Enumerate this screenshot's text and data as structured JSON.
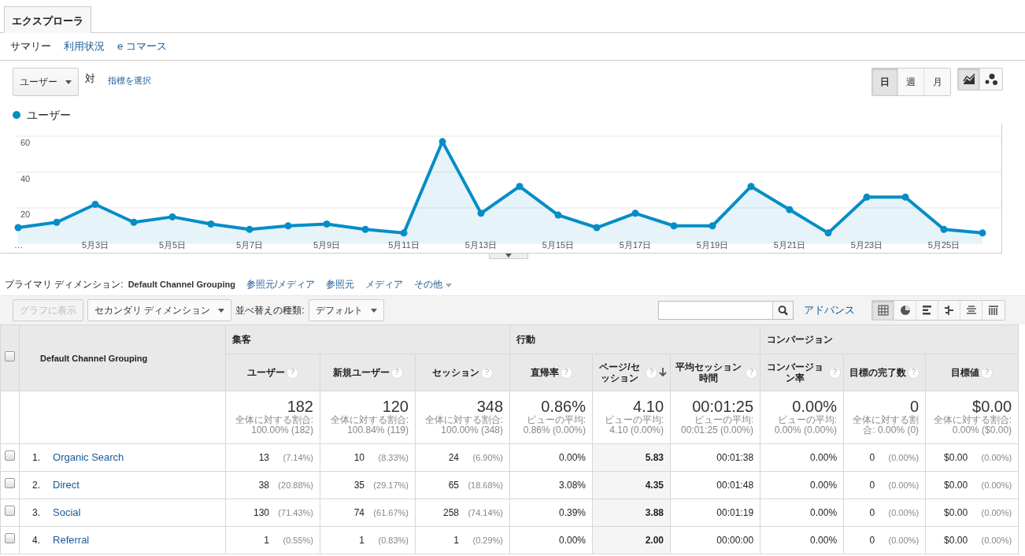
{
  "tabs": [
    {
      "label": "エクスプローラ",
      "selected": true
    }
  ],
  "subnav": [
    {
      "label": "サマリー",
      "selected": true
    },
    {
      "label": "利用状況",
      "selected": false
    },
    {
      "label": "e コマース",
      "selected": false
    }
  ],
  "metric_select": {
    "value": "ユーザー"
  },
  "vs_label": "対",
  "pick_metric_link": "指標を選択",
  "period_buttons": [
    {
      "label": "日",
      "selected": true
    },
    {
      "label": "週",
      "selected": false
    },
    {
      "label": "月",
      "selected": false
    }
  ],
  "chart_type_buttons": [
    {
      "kind": "line",
      "selected": true
    },
    {
      "kind": "motion",
      "selected": false
    }
  ],
  "chart": {
    "chart_data": {
      "type": "area",
      "categories": [
        "…",
        null,
        "5月3日",
        null,
        "5月5日",
        null,
        "5月7日",
        null,
        "5月9日",
        null,
        "5月11日",
        null,
        "5月13日",
        null,
        "5月15日",
        null,
        "5月17日",
        null,
        "5月19日",
        null,
        "5月21日",
        null,
        "5月23日",
        null,
        "5月25日",
        null
      ],
      "series": [
        {
          "name": "ユーザー",
          "color": "#058dc7",
          "values": [
            9,
            12,
            22,
            12,
            15,
            11,
            8,
            10,
            11,
            8,
            6,
            57,
            17,
            32,
            16,
            9,
            17,
            10,
            10,
            32,
            19,
            6,
            26,
            26,
            8,
            6
          ]
        }
      ],
      "ylim": [
        0,
        60
      ],
      "yticks": [
        20,
        40,
        60
      ],
      "grid": true
    }
  },
  "dimension_bar": {
    "label": "プライマリ ディメンション:",
    "items": [
      {
        "label": "Default Channel Grouping",
        "selected": true,
        "kind": "link"
      },
      {
        "label": "参照元/メディア",
        "selected": false,
        "kind": "link"
      },
      {
        "label": "参照元",
        "selected": false,
        "kind": "link"
      },
      {
        "label": "メディア",
        "selected": false,
        "kind": "link"
      },
      {
        "label": "その他",
        "selected": false,
        "kind": "dropdown"
      }
    ]
  },
  "toolbar": {
    "plot_button": {
      "label": "グラフに表示",
      "disabled": true
    },
    "secondary_dimension": "セカンダリ ディメンション",
    "sort_label": "並べ替えの種類:",
    "sort_value": "デフォルト",
    "advanced_link": "アドバンス",
    "view_buttons": [
      {
        "kind": "table",
        "selected": true
      },
      {
        "kind": "pie",
        "selected": false
      },
      {
        "kind": "performance",
        "selected": false
      },
      {
        "kind": "comparison",
        "selected": false
      },
      {
        "kind": "term-cloud",
        "selected": false
      },
      {
        "kind": "pivot",
        "selected": false
      }
    ]
  },
  "table": {
    "select_all": {
      "checked": false
    },
    "dimension_header": "Default Channel Grouping",
    "groups": [
      {
        "label": "集客",
        "columns": [
          {
            "label": "ユーザー",
            "help": "?",
            "sorted": false
          },
          {
            "label": "新規ユーザー",
            "help": "?",
            "sorted": false
          },
          {
            "label": "セッション",
            "help": "?",
            "sorted": false
          }
        ]
      },
      {
        "label": "行動",
        "columns": [
          {
            "label": "直帰率",
            "help": "?",
            "sorted": false
          },
          {
            "label": "ページ/セッション",
            "help": "?",
            "sorted": true
          },
          {
            "label": "平均セッション時間",
            "help": "?",
            "sorted": false
          }
        ]
      },
      {
        "label": "コンバージョン",
        "columns": [
          {
            "label": "コンバージョン率",
            "help": "?",
            "sorted": false
          },
          {
            "label": "目標の完了数",
            "help": "?",
            "sorted": false
          },
          {
            "label": "目標値",
            "help": "?",
            "sorted": false
          }
        ]
      }
    ],
    "totals": [
      {
        "value": "182",
        "note": "全体に対する割合: 100.00% (182)"
      },
      {
        "value": "120",
        "note": "全体に対する割合: 100.84% (119)"
      },
      {
        "value": "348",
        "note": "全体に対する割合: 100.00% (348)"
      },
      {
        "value": "0.86%",
        "note": "ビューの平均: 0.86% (0.00%)"
      },
      {
        "value": "4.10",
        "note": "ビューの平均: 4.10 (0.00%)"
      },
      {
        "value": "00:01:25",
        "note": "ビューの平均: 00:01:25 (0.00%)"
      },
      {
        "value": "0.00%",
        "note": "ビューの平均: 0.00% (0.00%)"
      },
      {
        "value": "0",
        "note": "全体に対する割合: 0.00% (0)"
      },
      {
        "value": "$0.00",
        "note": "全体に対する割合: 0.00% ($0.00)"
      }
    ],
    "rows": [
      {
        "checked": false,
        "index": "1.",
        "name": "Organic Search",
        "cells": [
          {
            "value": "13",
            "pct": "(7.14%)"
          },
          {
            "value": "10",
            "pct": "(8.33%)"
          },
          {
            "value": "24",
            "pct": "(6.90%)"
          },
          {
            "value": "0.00%"
          },
          {
            "value": "5.83"
          },
          {
            "value": "00:01:38"
          },
          {
            "value": "0.00%"
          },
          {
            "value": "0",
            "pct": "(0.00%)"
          },
          {
            "value": "$0.00",
            "pct": "(0.00%)"
          }
        ]
      },
      {
        "checked": false,
        "index": "2.",
        "name": "Direct",
        "cells": [
          {
            "value": "38",
            "pct": "(20.88%)"
          },
          {
            "value": "35",
            "pct": "(29.17%)"
          },
          {
            "value": "65",
            "pct": "(18.68%)"
          },
          {
            "value": "3.08%"
          },
          {
            "value": "4.35"
          },
          {
            "value": "00:01:48"
          },
          {
            "value": "0.00%"
          },
          {
            "value": "0",
            "pct": "(0.00%)"
          },
          {
            "value": "$0.00",
            "pct": "(0.00%)"
          }
        ]
      },
      {
        "checked": false,
        "index": "3.",
        "name": "Social",
        "cells": [
          {
            "value": "130",
            "pct": "(71.43%)"
          },
          {
            "value": "74",
            "pct": "(61.67%)"
          },
          {
            "value": "258",
            "pct": "(74.14%)"
          },
          {
            "value": "0.39%"
          },
          {
            "value": "3.88"
          },
          {
            "value": "00:01:19"
          },
          {
            "value": "0.00%"
          },
          {
            "value": "0",
            "pct": "(0.00%)"
          },
          {
            "value": "$0.00",
            "pct": "(0.00%)"
          }
        ]
      },
      {
        "checked": false,
        "index": "4.",
        "name": "Referral",
        "cells": [
          {
            "value": "1",
            "pct": "(0.55%)"
          },
          {
            "value": "1",
            "pct": "(0.83%)"
          },
          {
            "value": "1",
            "pct": "(0.29%)"
          },
          {
            "value": "0.00%"
          },
          {
            "value": "2.00"
          },
          {
            "value": "00:00:00"
          },
          {
            "value": "0.00%"
          },
          {
            "value": "0",
            "pct": "(0.00%)"
          },
          {
            "value": "$0.00",
            "pct": "(0.00%)"
          }
        ]
      }
    ]
  }
}
